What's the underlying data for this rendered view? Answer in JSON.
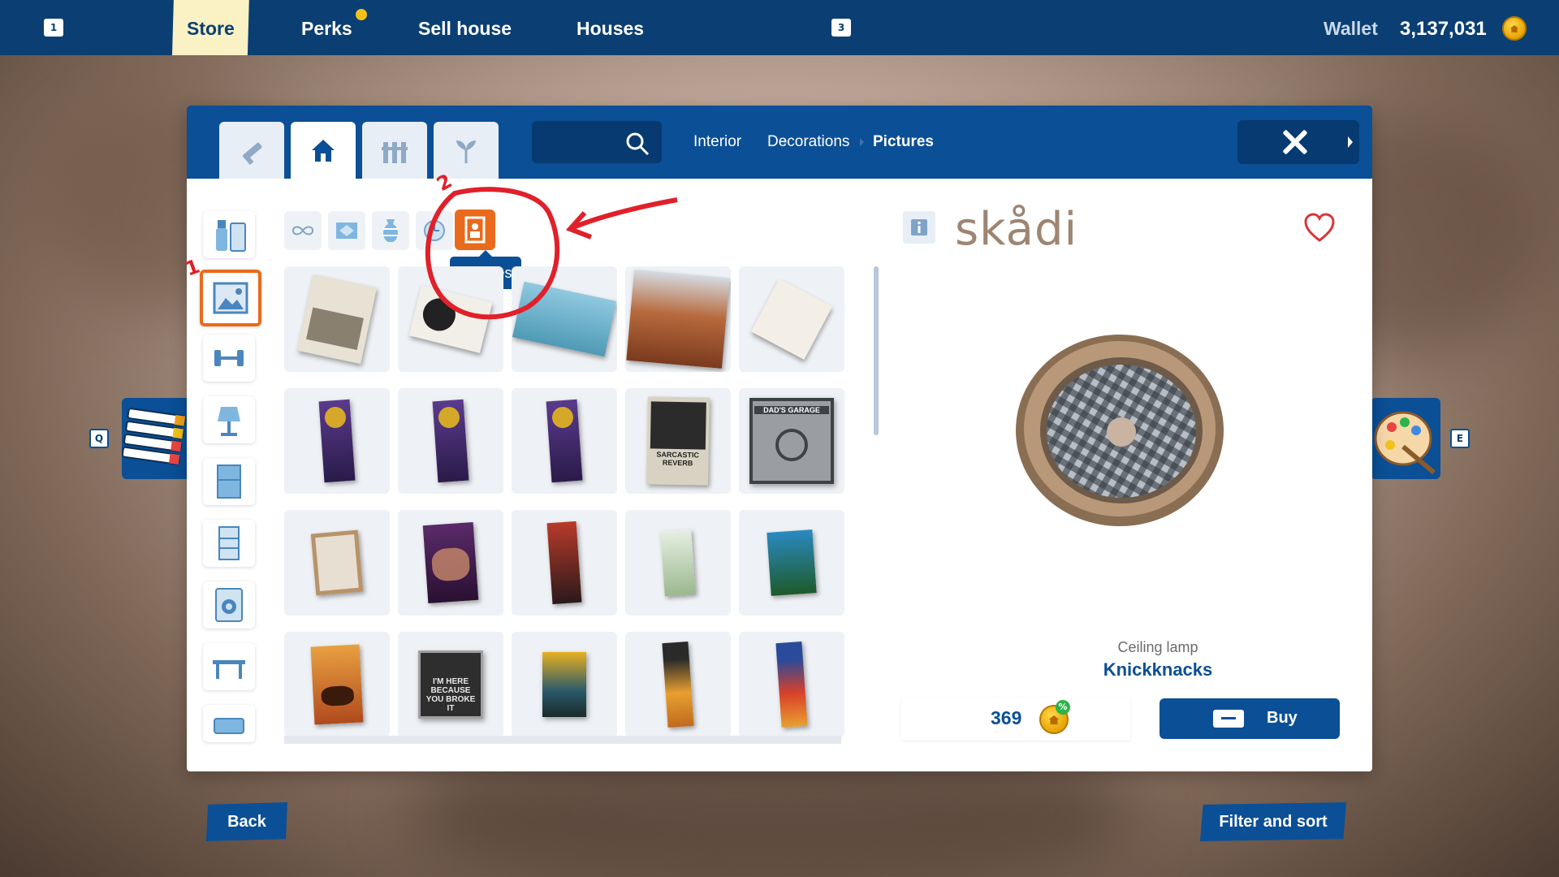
{
  "topbar": {
    "key_left": "1",
    "tabs": [
      {
        "label": "Store",
        "active": true
      },
      {
        "label": "Perks",
        "active": false
      },
      {
        "label": "Sell house",
        "active": false
      },
      {
        "label": "Houses",
        "active": false
      }
    ],
    "key_right": "3",
    "wallet_label": "Wallet",
    "wallet_value": "3,137,031"
  },
  "panel": {
    "category_tabs": [
      "hammer-icon",
      "house-icon",
      "fence-icon",
      "plant-icon"
    ],
    "active_category_tab": 1,
    "search": {
      "placeholder": ""
    },
    "breadcrumb": [
      "Interior",
      "Decorations",
      "Pictures"
    ],
    "side_categories": [
      "cleaning-icon",
      "picture-icon",
      "dumbbell-icon",
      "lamp-icon",
      "cabinet-icon",
      "drawer-icon",
      "washing-machine-icon",
      "table-icon",
      "sofa-icon"
    ],
    "active_side_category": 1,
    "subcategories": [
      "infinity-icon",
      "rug-icon",
      "vase-icon",
      "clock-icon",
      "frame-icon"
    ],
    "active_subcategory": 4,
    "tooltip": "Pictures",
    "poster_texts": {
      "sarcastic": "SARCASTIC REVERB",
      "garage": "DAD'S GARAGE",
      "here": "I'M HERE BECAUSE YOU BROKE IT"
    }
  },
  "detail": {
    "brand": "skådi",
    "subcategory": "Ceiling lamp",
    "name": "Knickknacks",
    "price": "369",
    "discount_badge": "%",
    "buy_label": "Buy"
  },
  "side_keys": {
    "left": "Q",
    "right": "E"
  },
  "bottom": {
    "back_label": "Back",
    "filter_label": "Filter and sort"
  },
  "annotation": {
    "label_1": "1",
    "label_2": "2",
    "color": "#e0202a"
  },
  "colors": {
    "primary": "#0b4f96",
    "topbar": "#0b3f73",
    "accent": "#ea6a1c",
    "coin": "#f3c21a"
  }
}
